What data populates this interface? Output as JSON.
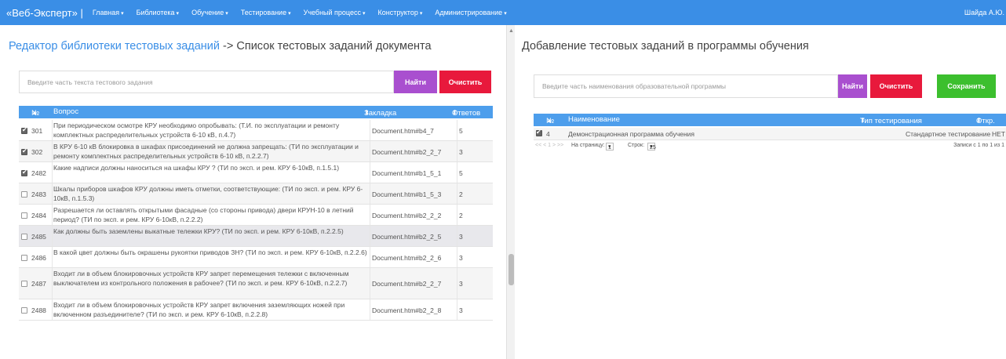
{
  "nav": {
    "brand": "«Веб-Эксперт» |",
    "items": [
      "Главная",
      "Библиотека",
      "Обучение",
      "Тестирование",
      "Учебный процесс",
      "Конструктор",
      "Администрирование"
    ],
    "user": "Шайда А.Ю."
  },
  "left": {
    "title_link": "Редактор библиотеки тестовых заданий",
    "title_rest": " -> Список тестовых заданий документа",
    "search_placeholder": "Введите часть текста тестового задания",
    "find_label": "Найти",
    "clear_label": "Очистить",
    "columns": [
      "№",
      "Вопрос",
      "Закладка",
      "Ответов"
    ],
    "rows": [
      {
        "checked": true,
        "num": "301",
        "question": "При периодическом осмотре КРУ необходимо опробывать: (Т.И. по эксплуатации и ремонту комплектных распределительных устройств 6-10 кВ, п.4.7)",
        "bookmark": "Document.htm#b4_7",
        "answers": "5"
      },
      {
        "checked": true,
        "num": "302",
        "question": "В КРУ 6-10 кВ блокировка в шкафах присоединений не должна запрещать: (ТИ по эксплуатации и ремонту комплектных распределительных устройств 6-10 кВ, п.2.2.7)",
        "bookmark": "Document.htm#b2_2_7",
        "answers": "3"
      },
      {
        "checked": true,
        "num": "2482",
        "question": "Какие надписи должны наноситься на шкафы КРУ ? (ТИ по эксп. и рем. КРУ 6-10кВ, п.1.5.1)",
        "bookmark": "Document.htm#b1_5_1",
        "answers": "5"
      },
      {
        "checked": false,
        "num": "2483",
        "question": "Шкалы приборов шкафов КРУ должны иметь отметки, соответствующие: (ТИ по эксп. и рем. КРУ 6-10кВ, п.1.5.3)",
        "bookmark": "Document.htm#b1_5_3",
        "answers": "2"
      },
      {
        "checked": false,
        "num": "2484",
        "question": "Разрешается ли оставлять открытыми фасадные (со стороны привода) двери КРУН-10 в летний период? (ТИ по эксп. и рем. КРУ 6-10кВ, п.2.2.2)",
        "bookmark": "Document.htm#b2_2_2",
        "answers": "2"
      },
      {
        "checked": false,
        "num": "2485",
        "question": "Как должны быть заземлены выкатные тележки КРУ? (ТИ по эксп. и рем. КРУ 6-10кВ, п.2.2.5)",
        "bookmark": "Document.htm#b2_2_5",
        "answers": "3"
      },
      {
        "checked": false,
        "num": "2486",
        "question": "В какой цвет должны быть окрашены рукоятки приводов ЗН? (ТИ по эксп. и рем. КРУ 6-10кВ, п.2.2.6)",
        "bookmark": "Document.htm#b2_2_6",
        "answers": "3"
      },
      {
        "checked": false,
        "num": "2487",
        "question": "Входит ли в объем блокировочных устройств КРУ запрет перемещения тележки с включенным выключателем из контрольного положения в рабочее? (ТИ по эксп. и рем. КРУ 6-10кВ, п.2.2.7)",
        "bookmark": "Document.htm#b2_2_7",
        "answers": "3"
      },
      {
        "checked": false,
        "num": "2488",
        "question": "Входит ли в объем блокировочных устройств КРУ запрет включения заземляющих ножей при включенном разъединителе? (ТИ по эксп. и рем. КРУ 6-10кВ, п.2.2.8)",
        "bookmark": "Document.htm#b2_2_8",
        "answers": "3"
      }
    ]
  },
  "right": {
    "title": "Добавление тестовых заданий в программы обучения",
    "search_placeholder": "Введите часть наименования образовательной программы",
    "find_label": "Найти",
    "clear_label": "Очистить",
    "save_label": "Сохранить",
    "columns": [
      "№",
      "Наименование",
      "Тип тестирования",
      "Откр."
    ],
    "row": {
      "checked": true,
      "num": "4",
      "name": "Демонстрационная программа обучения",
      "type": "Стандартное тестирование",
      "open": "НЕТ"
    },
    "pager": {
      "nav": "<< < 1 > >>",
      "page_label": "На страницу:",
      "page_value": "1",
      "rows_label": "Строк:",
      "rows_value": "25",
      "records": "Записи с 1 по 1 из 1"
    }
  },
  "colors": {
    "navbar": "#3a8ee6",
    "table_header": "#4d9eec",
    "find": "#a94fcf",
    "clear": "#e8193c",
    "save": "#3cbf2e"
  }
}
